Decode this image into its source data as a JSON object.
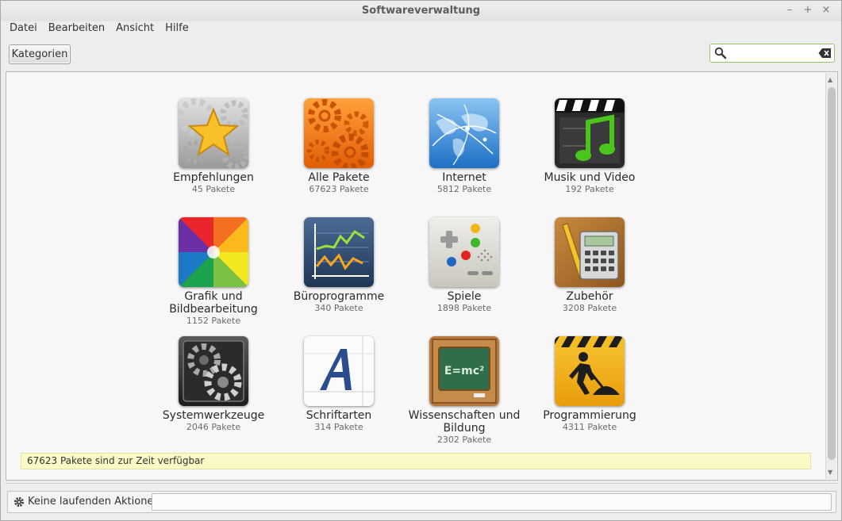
{
  "window": {
    "title": "Softwareverwaltung",
    "controls": [
      "–",
      "+",
      "×"
    ]
  },
  "menu": [
    "Datei",
    "Bearbeiten",
    "Ansicht",
    "Hilfe"
  ],
  "toolbar": {
    "categories_button": "Kategorien",
    "search_value": "",
    "search_icon": "search-icon",
    "clear_icon": "clear-icon"
  },
  "categories": [
    {
      "name": "Empfehlungen",
      "count": "45 Pakete",
      "icon": "star-gears-icon"
    },
    {
      "name": "Alle Pakete",
      "count": "67623 Pakete",
      "icon": "orange-gears-icon"
    },
    {
      "name": "Internet",
      "count": "5812 Pakete",
      "icon": "globe-network-icon"
    },
    {
      "name": "Musik und Video",
      "count": "192 Pakete",
      "icon": "clapper-music-icon"
    },
    {
      "name": "Grafik und Bildbearbeitung",
      "count": "1152 Pakete",
      "icon": "color-wheel-icon"
    },
    {
      "name": "Büroprogramme",
      "count": "340 Pakete",
      "icon": "line-chart-icon"
    },
    {
      "name": "Spiele",
      "count": "1898 Pakete",
      "icon": "gamepad-icon"
    },
    {
      "name": "Zubehör",
      "count": "3208 Pakete",
      "icon": "calculator-pencil-icon"
    },
    {
      "name": "Systemwerkzeuge",
      "count": "2046 Pakete",
      "icon": "dark-gears-icon"
    },
    {
      "name": "Schriftarten",
      "count": "314 Pakete",
      "icon": "font-letter-icon"
    },
    {
      "name": "Wissenschaften und Bildung",
      "count": "2302 Pakete",
      "icon": "chalkboard-icon"
    },
    {
      "name": "Programmierung",
      "count": "4311 Pakete",
      "icon": "construction-sign-icon"
    }
  ],
  "info": "67623 Pakete sind zur Zeit verfügbar",
  "status": {
    "text": "Keine laufenden Aktionen",
    "icon": "gear-icon"
  }
}
